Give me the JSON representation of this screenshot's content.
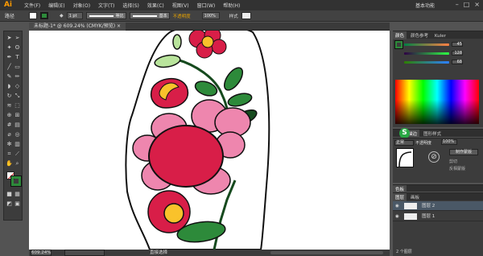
{
  "app": {
    "logo": "Ai",
    "workspace": "基本功能"
  },
  "menu": [
    "文件(F)",
    "编辑(E)",
    "对象(O)",
    "文字(T)",
    "选择(S)",
    "效果(C)",
    "视图(V)",
    "窗口(W)",
    "帮助(H)"
  ],
  "control": {
    "label": "路径",
    "stroke_weight": "1 pt",
    "profile": "等比",
    "brush": "基本",
    "opacity_label": "不透明度",
    "opacity": "100%",
    "style_label": "样式"
  },
  "document": {
    "tab_title": "未标题-1* @ 609.24% (CMYK/预览)"
  },
  "status": {
    "zoom": "609.24%",
    "tool": "直接选择"
  },
  "colors": {
    "flower": "#d81e48",
    "petal": "#ee86ae",
    "yellow": "#f9c22b",
    "leaf": "#2d8a3a",
    "light_leaf": "#b9e49c",
    "stem": "#164a1e"
  },
  "panels": {
    "color": {
      "tabs": [
        "颜色",
        "颜色参考",
        "Kuler"
      ],
      "r": "45",
      "g": "128",
      "b": "68"
    },
    "gradient": {
      "tabs": [
        "渐变",
        "透明度"
      ],
      "mode": "正常",
      "opacity_label": "不透明度",
      "opacity": "100%",
      "make_mask": "制作蒙版",
      "clip": "剪切",
      "invert_mask": "反相蒙版"
    },
    "symbols": {
      "tabs": [
        "描边",
        "图形样式"
      ]
    },
    "layers": {
      "tabs": [
        "图层",
        "画板"
      ],
      "items": [
        "图层 2",
        "图层 1"
      ],
      "footer": "2 个图层"
    },
    "swatch_label": "色板"
  }
}
